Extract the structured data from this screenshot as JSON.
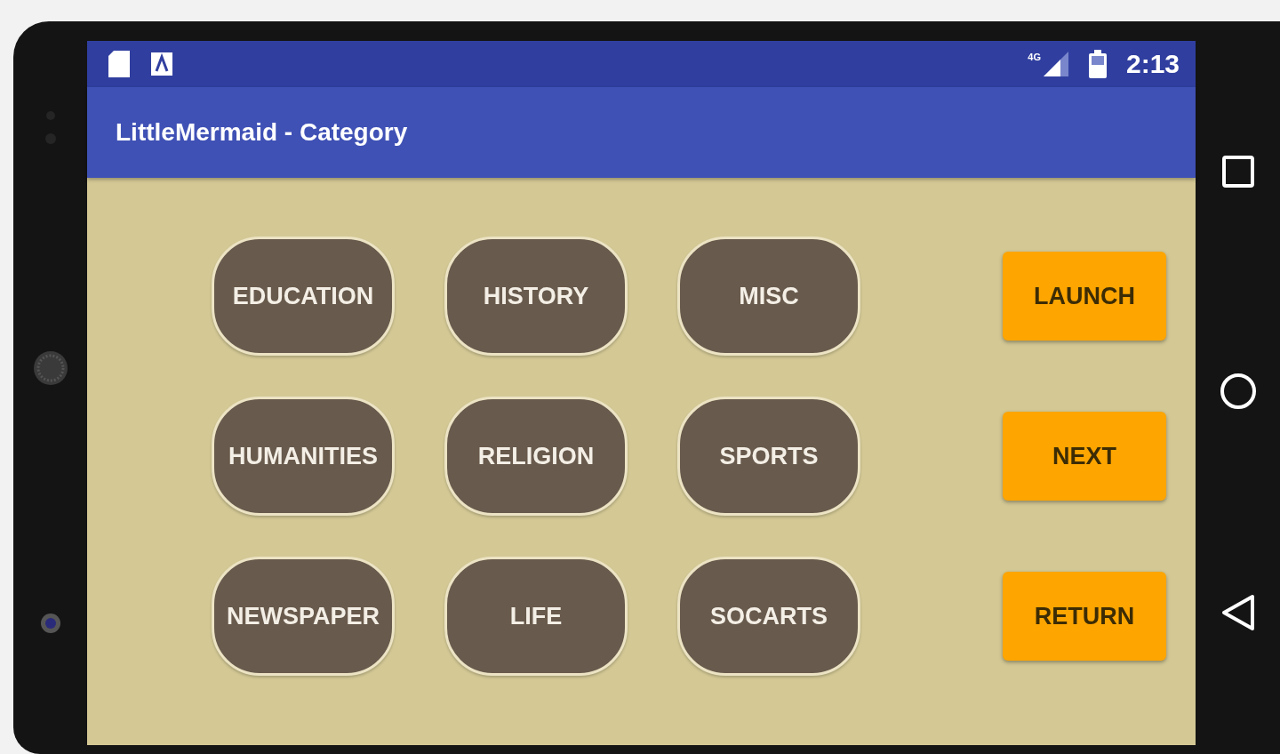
{
  "status_bar": {
    "network": "4G",
    "time": "2:13"
  },
  "app_bar": {
    "title": "LittleMermaid - Category"
  },
  "categories": [
    "EDUCATION",
    "HISTORY",
    "MISC",
    "HUMANITIES",
    "RELIGION",
    "SPORTS",
    "NEWSPAPER",
    "LIFE",
    "SOCARTS"
  ],
  "actions": [
    "LAUNCH",
    "NEXT",
    "RETURN"
  ]
}
